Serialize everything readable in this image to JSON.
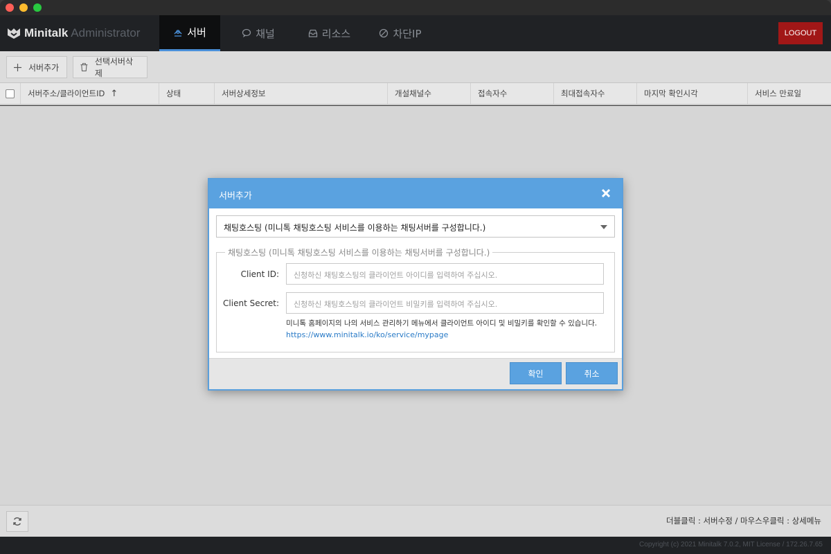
{
  "app": {
    "logo_text": "Minitalk",
    "logo_sub": "Administrator",
    "logout_label": "LOGOUT"
  },
  "nav": {
    "tabs": [
      {
        "label": "서버",
        "icon": "server-icon",
        "active": true
      },
      {
        "label": "채널",
        "icon": "chat-icon",
        "active": false
      },
      {
        "label": "리소스",
        "icon": "inbox-icon",
        "active": false
      },
      {
        "label": "차단IP",
        "icon": "block-icon",
        "active": false
      }
    ]
  },
  "toolbar": {
    "add_label": "서버추가",
    "delete_label": "선택서버삭제"
  },
  "table": {
    "columns": [
      "서버주소/클라이언트ID",
      "상태",
      "서버상세정보",
      "개설채널수",
      "접속자수",
      "최대접속자수",
      "마지막 확인시각",
      "서비스 만료일"
    ],
    "sort_indicator": "↑",
    "rows": []
  },
  "footer": {
    "hint": "더블클릭 : 서버수정 / 마우스우클릭 : 상세메뉴",
    "copyright": "Copyright (c) 2021 Minitalk 7.0.2, MIT License / 172.26.7.65"
  },
  "modal": {
    "title": "서버추가",
    "select_value": "채팅호스팅 (미니톡 채팅호스팅 서비스를 이용하는 채팅서버를 구성합니다.)",
    "fieldset_legend": "채팅호스팅 (미니톡 채팅호스팅 서비스를 이용하는 채팅서버를 구성합니다.)",
    "client_id_label": "Client ID:",
    "client_id_placeholder": "신청하신 채팅호스팅의 클라이언트 아이디를 입력하여 주십시오.",
    "client_secret_label": "Client Secret:",
    "client_secret_placeholder": "신청하신 채팅호스팅의 클라이언트 비밀키를 입력하여 주십시오.",
    "help_text": "미니톡 홈페이지의 나의 서비스 관리하기 메뉴에서 클라이언트 아이디 및 비밀키를 확인할 수 있습니다.",
    "help_link": "https://www.minitalk.io/ko/service/mypage",
    "confirm_label": "확인",
    "cancel_label": "취소"
  },
  "colors": {
    "accent": "#5aa2e0",
    "header_bg": "#202225",
    "logout_bg": "#a11717"
  }
}
